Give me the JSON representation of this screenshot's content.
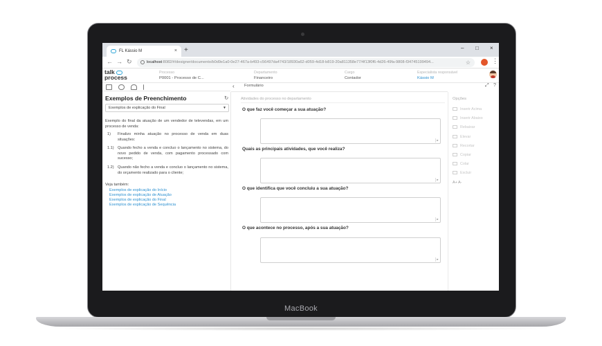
{
  "device": {
    "brand": "MacBook"
  },
  "browser": {
    "tab_title": "FL Kássio M",
    "new_tab": "+",
    "tab_close": "×",
    "url_host": "localhost",
    "url_rest": ":8082/#/designer/documento/b0d9e1a0-0e27-467a-b493-c56497da4743/18930a62-d059-4d18-b819-20a811358e77/4f13f0f6-4d26-49fa-9808-f34745199494...",
    "window_controls": [
      "–",
      "□",
      "×"
    ],
    "nav": {
      "back": "←",
      "forward": "→",
      "reload": "↻"
    }
  },
  "app": {
    "logo": {
      "line1": "talk",
      "line2": "process"
    },
    "fields": [
      {
        "label": "Processo",
        "value": "P0001 - Processo de C..."
      },
      {
        "label": "Departamento",
        "value": "Financeiro"
      },
      {
        "label": "Cargo",
        "value": "Contador"
      },
      {
        "label": "Especialista responsável",
        "value": "Kássio M"
      }
    ]
  },
  "left": {
    "collapse": "‹",
    "title": "Exemplos de Preenchimento",
    "refresh": "↻",
    "select_value": "Exemplos de explicação do Final",
    "intro": "Exemplo do final da atuação de um vendedor de televendas, em um processo de venda:",
    "items": [
      {
        "num": "1)",
        "text": "Finalizo minha atuação no processo de venda em duas situações:"
      },
      {
        "num": "1.1)",
        "text": "Quando fecho a venda e concluo o lançamento no sistema, do novo pedido de venda, com pagamento processado com sucesso;"
      },
      {
        "num": "1.2)",
        "text": "Quando não fecho a venda e concluo o lançamento no sistema, do orçamento realizado para o cliente;"
      }
    ],
    "see_also": "Veja também:",
    "links": [
      "Exemplos de explicação do Início",
      "Exemplos de explicação de Atuação",
      "Exemplos de explicação do Final",
      "Exemplos de explicação de Sequência"
    ]
  },
  "main": {
    "tab_label": "Formulário",
    "expand_icon": "⤢",
    "help_icon": "?",
    "section": "Atividades do processo no departamento",
    "questions": [
      "O que faz você começar a sua atuação?",
      "Quais as principais atividades, que você realiza?",
      "O que identifica que você concluiu a sua atuação?",
      "O que acontece no processo, após a sua atuação?"
    ]
  },
  "options": {
    "title": "Opções",
    "items": [
      "Inserir Acima",
      "Inserir Abaixo",
      "Rebaixar",
      "Elevar",
      "Recortar",
      "Copiar",
      "Colar",
      "Excluir"
    ],
    "font_size": "A+  A-"
  }
}
